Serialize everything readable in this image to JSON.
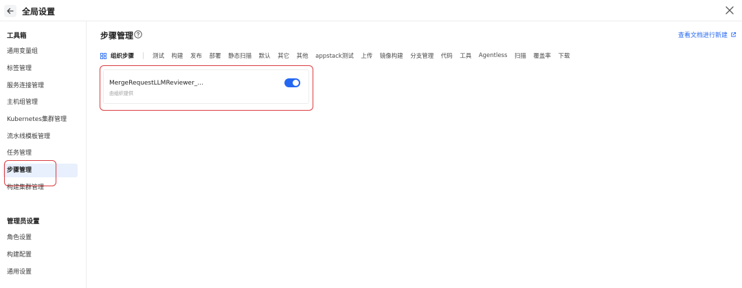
{
  "header": {
    "title": "全局设置"
  },
  "sidebar": {
    "section_toolbox": "工具箱",
    "toolbox_items": [
      {
        "label": "通用变量组"
      },
      {
        "label": "标签管理"
      },
      {
        "label": "服务连接管理"
      },
      {
        "label": "主机组管理"
      },
      {
        "label": "Kubernetes集群管理"
      },
      {
        "label": "流水线模板管理"
      },
      {
        "label": "任务管理"
      },
      {
        "label": "步骤管理",
        "active": true
      },
      {
        "label": "构建集群管理"
      }
    ],
    "section_admin": "管理员设置",
    "admin_items": [
      {
        "label": "角色设置"
      },
      {
        "label": "构建配置"
      },
      {
        "label": "通用设置"
      }
    ]
  },
  "main": {
    "title": "步骤管理",
    "doc_link": "查看文档进行新建",
    "tab_active": "组织步骤",
    "tabs": [
      "测试",
      "构建",
      "发布",
      "部署",
      "静态扫描",
      "默认",
      "其它",
      "其他",
      "appstack测试",
      "上传",
      "镜像构建",
      "分支管理",
      "代码",
      "工具",
      "Agentless",
      "扫描",
      "覆盖率",
      "下载"
    ],
    "card": {
      "name": "MergeRequestLLMReviewer_...",
      "provider": "由组织提供",
      "enabled": true
    }
  },
  "colors": {
    "accent": "#2468f2",
    "highlight": "#d9393e",
    "active_bg": "#e8f0fd"
  }
}
